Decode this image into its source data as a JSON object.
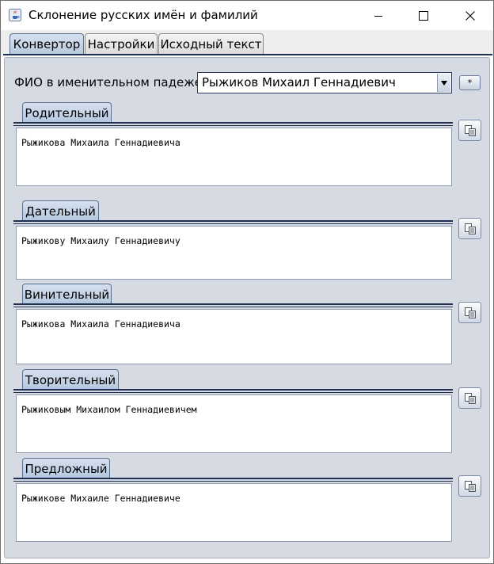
{
  "window": {
    "title": "Склонение русских имён и фамилий"
  },
  "tabs": [
    {
      "label": "Конвертор",
      "active": true
    },
    {
      "label": "Настройки",
      "active": false
    },
    {
      "label": "Исходный текст",
      "active": false
    }
  ],
  "input": {
    "label": "ФИО в именительном падеже:",
    "value": "Рыжиков Михаил Геннадиевич",
    "extra_button": "*"
  },
  "cases": [
    {
      "label": "Родительный",
      "result": "Рыжикова Михаила Геннадиевича"
    },
    {
      "label": "Дательный",
      "result": "Рыжикову Михаилу Геннадиевичу"
    },
    {
      "label": "Винительный",
      "result": "Рыжикова Михаила Геннадиевича"
    },
    {
      "label": "Творительный",
      "result": "Рыжиковым Михаилом Геннадиевичем"
    },
    {
      "label": "Предложный",
      "result": "Рыжикове Михаиле Геннадиевиче"
    }
  ],
  "colors": {
    "accent": "#1f2f52",
    "panel": "#d6dbe3",
    "active_tab": "#b8cadf"
  }
}
